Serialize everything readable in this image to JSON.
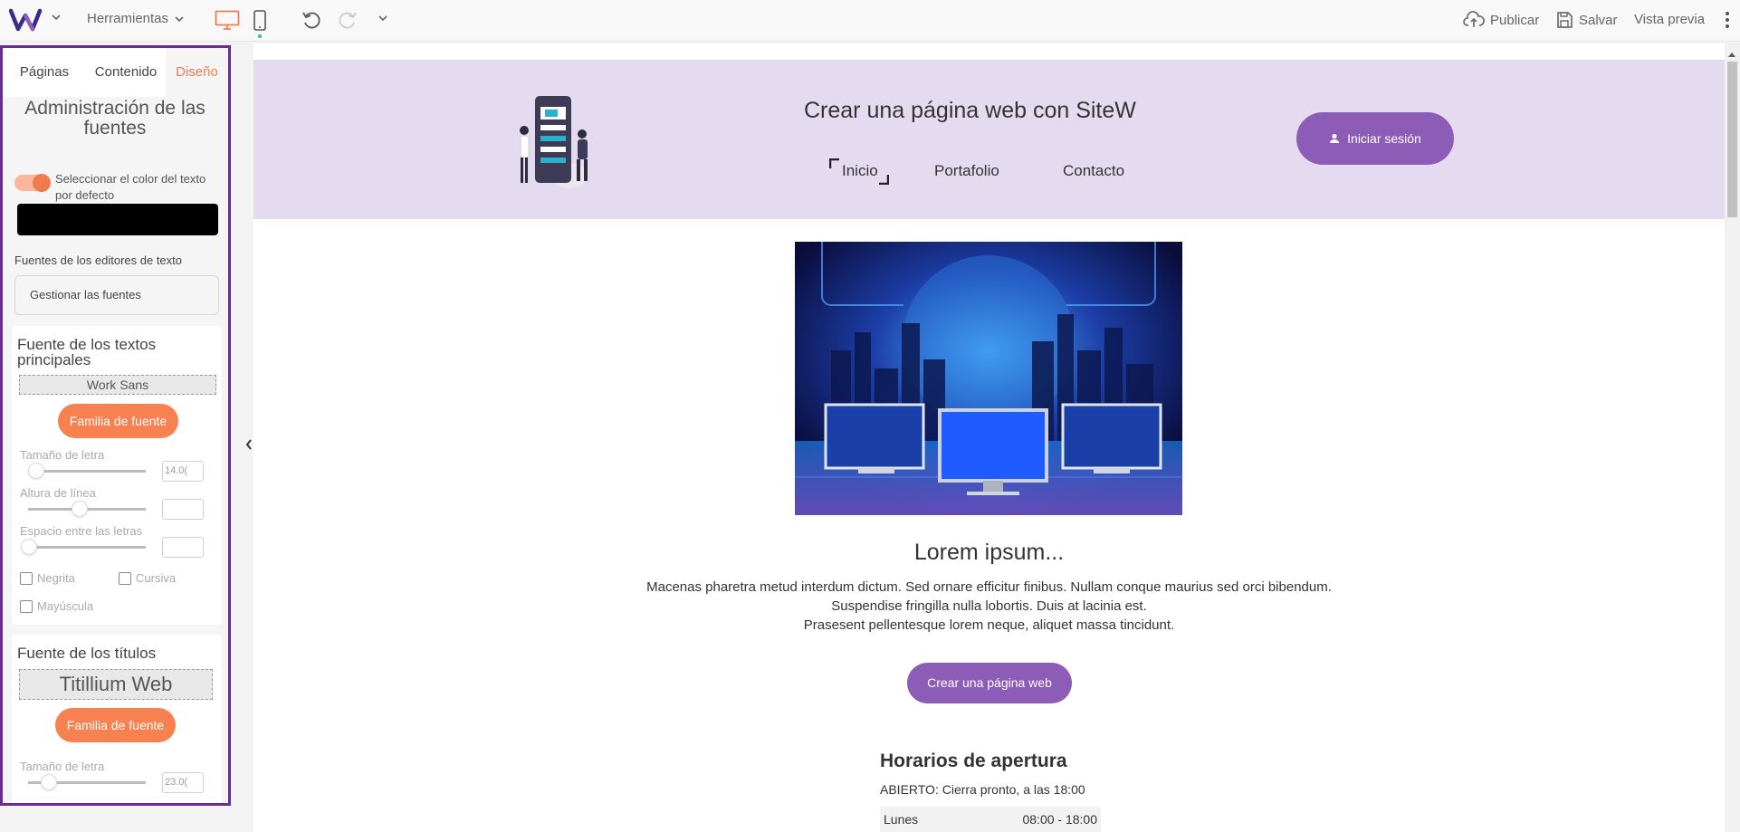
{
  "colors": {
    "accent": "#f07c4d",
    "purple": "#8c5cb6",
    "panel_border": "#6b2c91",
    "header_band": "#e5dbf0"
  },
  "topbar": {
    "tools_label": "Herramientas",
    "publish_label": "Publicar",
    "save_label": "Salvar",
    "preview_label": "Vista previa",
    "icons": [
      "sitew-logo-icon",
      "chevron-down-icon",
      "desktop-icon",
      "mobile-icon",
      "undo-icon",
      "redo-icon",
      "upload-cloud-icon",
      "save-icon",
      "kebab-menu-icon"
    ]
  },
  "panel": {
    "tabs": [
      {
        "label": "Páginas",
        "active": false
      },
      {
        "label": "Contenido",
        "active": false
      },
      {
        "label": "Diseño",
        "active": true
      }
    ],
    "title": "Administración de las fuentes",
    "toggle_label": "Seleccionar el color del texto por defecto",
    "default_text_color": "#000000",
    "editors_label": "Fuentes de los editores de texto",
    "manage_fonts_label": "Gestionar las fuentes",
    "main_fonts": {
      "heading": "Fuente de los textos principales",
      "font_name": "Work Sans",
      "family_button": "Familia de fuente",
      "size_label": "Tamaño de letra",
      "size_value": "14.0(",
      "line_height_label": "Altura de línea",
      "letter_spacing_label": "Espacio entre las letras",
      "bold_label": "Negrita",
      "italic_label": "Cursiva",
      "uppercase_label": "Mayúscula"
    },
    "title_fonts": {
      "heading": "Fuente de los títulos",
      "font_name": "Titillium Web",
      "family_button": "Familia de fuente",
      "size_label": "Tamaño de letra",
      "size_value": "23.0("
    }
  },
  "site": {
    "title": "Crear una página web con SiteW",
    "nav": [
      "Inicio",
      "Portafolio",
      "Contacto"
    ],
    "login_label": "Iniciar sesión",
    "lorem_heading": "Lorem ipsum...",
    "lorem_lines": [
      "Macenas pharetra metud interdum dictum. Sed ornare efficitur finibus. Nullam conque maurius sed orci bibendum.",
      "Suspendise fringilla nulla lobortis. Duis at lacinia est.",
      "Prasesent pellentesque lorem neque, aliquet massa tincidunt."
    ],
    "cta_label": "Crear una página web",
    "hours_heading": "Horarios de apertura",
    "hours_status": "ABIERTO: Cierra pronto, a las 18:00",
    "hours_rows": [
      {
        "day": "Lunes",
        "time": "08:00 - 18:00"
      }
    ]
  }
}
